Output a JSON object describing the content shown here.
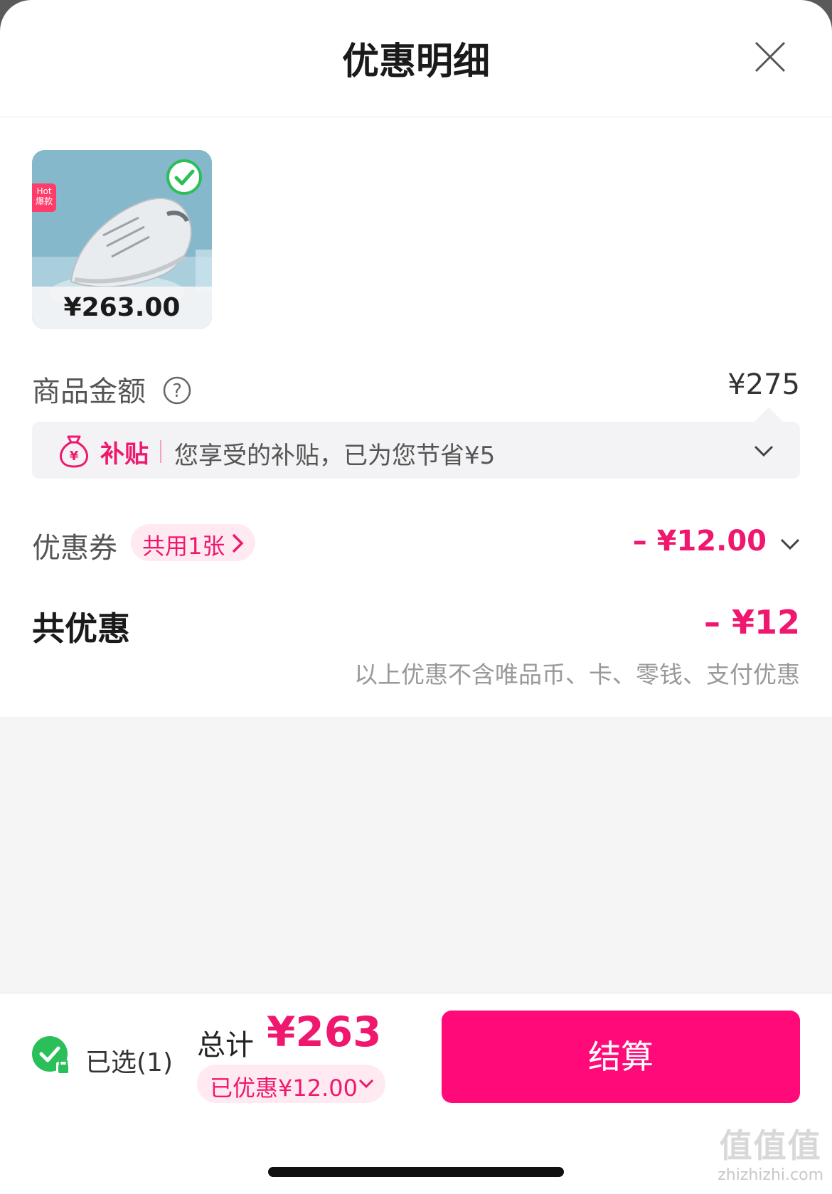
{
  "header": {
    "title": "优惠明细"
  },
  "product": {
    "price": "¥263.00",
    "hot_tag": "Hot\n爆款",
    "selected": true
  },
  "goods_amount": {
    "label": "商品金额",
    "value": "¥275"
  },
  "subsidy": {
    "tag": "补贴",
    "text": "您享受的补贴，已为您节省¥5"
  },
  "coupon": {
    "label": "优惠券",
    "pill": "共用1张",
    "value": "– ¥12.00"
  },
  "total_discount": {
    "label": "共优惠",
    "value": "– ¥12",
    "note": "以上优惠不含唯品币、卡、零钱、支付优惠"
  },
  "footer": {
    "selected_text": "已选(1)",
    "total_label": "总计",
    "total_value": "¥263",
    "saved_text": "已优惠¥12.00",
    "checkout_label": "结算"
  },
  "watermark": {
    "big": "值值值",
    "small": "zhizhizhi.com"
  },
  "colors": {
    "accent": "#f0186e",
    "button": "#ff0a78",
    "check": "#2bbf5a"
  }
}
